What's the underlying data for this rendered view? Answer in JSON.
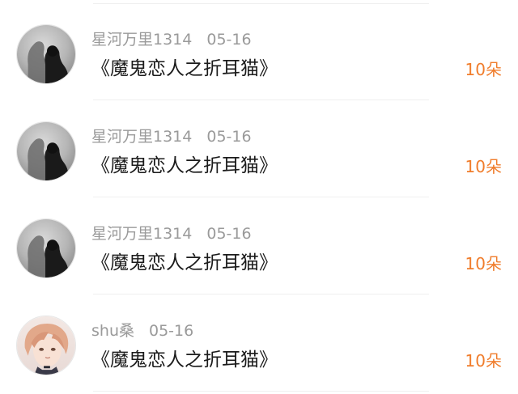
{
  "list": {
    "items": [
      {
        "username": "星河万里1314",
        "date": "05-16",
        "message": "《魔鬼恋人之折耳猫》",
        "gift": "10朵",
        "avatar_icon": "couple-silhouette-avatar"
      },
      {
        "username": "星河万里1314",
        "date": "05-16",
        "message": "《魔鬼恋人之折耳猫》",
        "gift": "10朵",
        "avatar_icon": "couple-silhouette-avatar"
      },
      {
        "username": "星河万里1314",
        "date": "05-16",
        "message": "《魔鬼恋人之折耳猫》",
        "gift": "10朵",
        "avatar_icon": "couple-silhouette-avatar"
      },
      {
        "username": "shu桑",
        "date": "05-16",
        "message": "《魔鬼恋人之折耳猫》",
        "gift": "10朵",
        "avatar_icon": "anime-boy-avatar"
      }
    ]
  },
  "colors": {
    "gift": "#f07d2c",
    "meta": "#9a9a9a",
    "message": "#1b1b1b",
    "divider": "#efefef"
  }
}
